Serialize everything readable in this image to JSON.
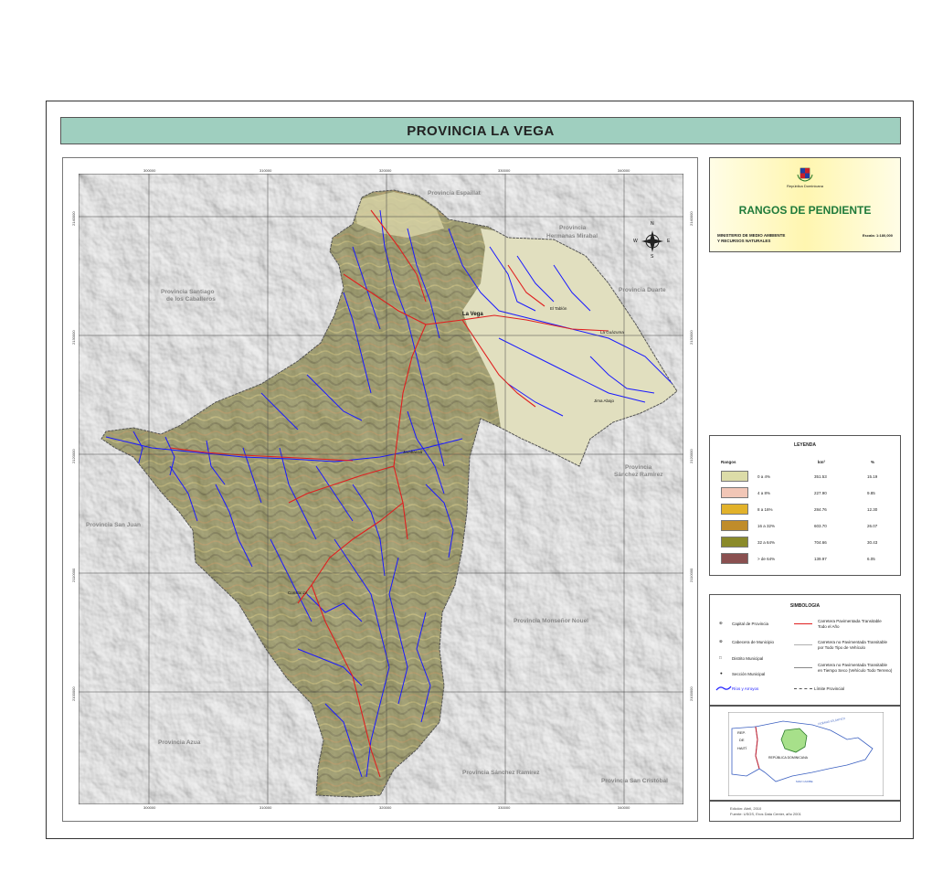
{
  "title": "PROVINCIA LA VEGA",
  "header": {
    "republic": "República Dominicana",
    "map_title": "RANGOS DE PENDIENTE",
    "ministry_line1": "MINISTERIO DE MEDIO AMBIENTE",
    "ministry_line2": "Y RECURSOS NATURALES",
    "scale": "Escala: 1:180,000"
  },
  "coords": {
    "x_ticks": [
      "300000",
      "310000",
      "320000",
      "330000",
      "340000"
    ],
    "y_ticks": [
      "2140000",
      "2130000",
      "2120000",
      "2110000",
      "2100000"
    ]
  },
  "compass": {
    "n": "N",
    "s": "S",
    "e": "E",
    "w": "W"
  },
  "provinces": {
    "espaillat": "Provincia Espaillat",
    "hermanas_1": "Provincia",
    "hermanas_2": "Hermanas Mirabal",
    "duarte": "Provincia Duarte",
    "santiago_1": "Provincia Santiago",
    "santiago_2": "de los Caballeros",
    "sanchez_1": "Provincia",
    "sanchez_2": "Sánchez Ramírez",
    "san_juan": "Provincia San Juan",
    "monsenor": "Provincia Monseñor Nouel",
    "azua": "Provincia Azua",
    "sanchez_s": "Provincia Sánchez Ramírez",
    "san_cristobal": "Provincia San Cristóbal"
  },
  "towns": {
    "la_vega": "La Vega",
    "jarabacoa": "Jarabacoa",
    "constanza": "Constanza",
    "jima_abajo": "Jima Abajo",
    "la_guazuma": "La Guázuma",
    "el_tablon": "El Tablón"
  },
  "legend": {
    "title": "LEYENDA",
    "head_rangos": "Rangos",
    "head_km": "km²",
    "head_pct": "%",
    "rows": [
      {
        "range": "0 a 4%",
        "km": "351.53",
        "pct": "15.19",
        "color": "#dcdca8"
      },
      {
        "range": "4 a 8%",
        "km": "227.90",
        "pct": "9.85",
        "color": "#f1c6b6"
      },
      {
        "range": "8 a 16%",
        "km": "284.76",
        "pct": "12.30",
        "color": "#e2b22a"
      },
      {
        "range": "16 a 32%",
        "km": "603.70",
        "pct": "26.07",
        "color": "#c08c2a"
      },
      {
        "range": "32 a 64%",
        "km": "704.66",
        "pct": "30.43",
        "color": "#8a8a2a"
      },
      {
        "range": "> de 64%",
        "km": "139.97",
        "pct": "6.05",
        "color": "#8a5050"
      }
    ]
  },
  "simbologia": {
    "title": "SIMBOLOGIA",
    "capital": "Capital de Provincia",
    "cabecera": "Cabecera de Municipio",
    "distrito": "Distrito Municipal",
    "seccion": "Sección Municipal",
    "rios": "Ríos y Arroyos",
    "carretera1_1": "Carretera Pavimentada Transitable",
    "carretera1_2": "Todo el Año",
    "carretera2_1": "Carretera no Pavimentada Transitable",
    "carretera2_2": "por Todo Tipo de Vehículo",
    "carretera3_1": "Carretera no Pavimentada Transitable",
    "carretera3_2": "en Tiempo Seco (Vehículo Todo Terreno)",
    "limite": "Límite Provincial"
  },
  "locator": {
    "rep": "REP.",
    "de": "DE",
    "haiti": "HAITÍ",
    "rd": "REPÚBLICA DOMINICANA",
    "ocean": "OCÉANO ATLÁNTICO",
    "sea": "MAR CARIBE"
  },
  "footer": {
    "line1": "Edición: Abril, 2010",
    "line2": "Fuente: USGS, Eros Data Center, año 2001"
  },
  "colors": {
    "title_bar": "#9fcfbf",
    "rivers": "#1a1aff",
    "roads": "#e02020",
    "header_title": "#1f7a3a"
  }
}
